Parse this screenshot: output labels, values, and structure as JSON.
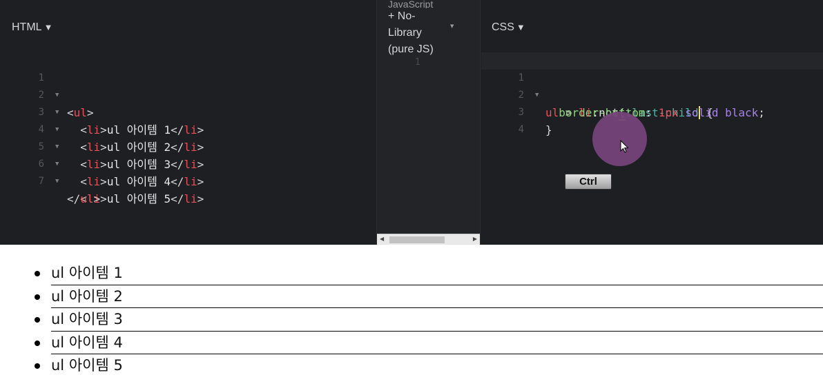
{
  "html_pane": {
    "label": "HTML",
    "caret": "▼",
    "line_numbers": [
      "1",
      "2",
      "3",
      "4",
      "5",
      "6",
      "7"
    ],
    "items": [
      "ul 아이템 1",
      "ul 아이템 2",
      "ul 아이템 3",
      "ul 아이템 4",
      "ul 아이템 5"
    ]
  },
  "js_pane": {
    "label_top": "JavaScript",
    "label_line1": "+ No-",
    "label_line2": "Library",
    "label_line3": "(pure JS)",
    "line_number": "1"
  },
  "css_pane": {
    "label": "CSS",
    "caret": "▼",
    "line_numbers": [
      "1",
      "2",
      "3",
      "4"
    ],
    "selector_ul": "ul",
    "combinator": " > ",
    "selector_li": "li",
    "pseudo": ":not",
    "pseudo_arg": ":last-child",
    "property": "border-bottom",
    "value_num": "1px",
    "value_style": "solid",
    "value_color": "black"
  },
  "overlay": {
    "key_label": "Ctrl",
    "circle_color": "#75437a"
  },
  "result": {
    "items": [
      "ul 아이템 1",
      "ul 아이템 2",
      "ul 아이템 3",
      "ul 아이템 4",
      "ul 아이템 5"
    ]
  },
  "colors": {
    "editor_bg": "#1e1f22",
    "tag": "#e8505b",
    "property": "#8bd27b",
    "keyword": "#a782e8",
    "pseudo_class": "#4fb2a2"
  }
}
